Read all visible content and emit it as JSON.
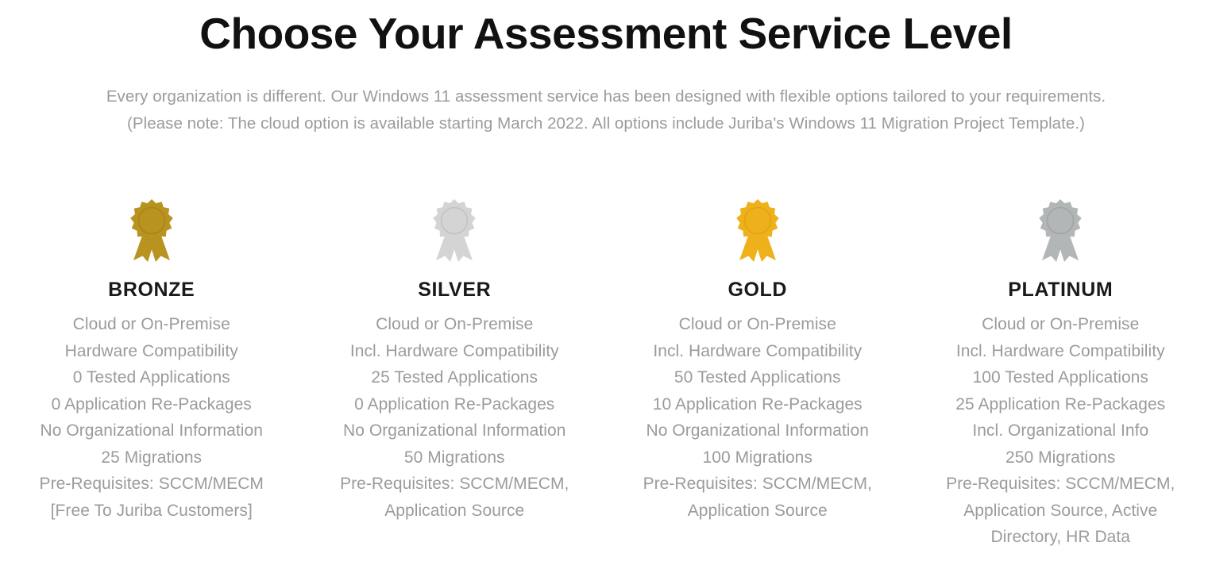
{
  "header": {
    "title": "Choose Your Assessment Service Level",
    "intro_line_1": "Every organization is different. Our Windows 11 assessment service has been designed with flexible options tailored to your requirements.",
    "intro_line_2": "(Please note: The cloud option is available starting March 2022. All options include Juriba's Windows 11 Migration Project Template.)"
  },
  "colors": {
    "title": "#111111",
    "body_text": "#9b9b9b",
    "background": "#ffffff",
    "bronze": "#b8931f",
    "bronze_dark": "#a98317",
    "silver": "#d4d4d4",
    "silver_dark": "#c2c2c2",
    "gold": "#eeb11c",
    "gold_dark": "#e0a313",
    "platinum": "#b3b6b7",
    "platinum_dark": "#a0a4a5"
  },
  "tiers": [
    {
      "name": "BRONZE",
      "medal_icon": "award-ribbon-icon",
      "medal_color": "#b8931f",
      "medal_color_dark": "#a98317",
      "features": [
        "Cloud or On-Premise",
        "Hardware Compatibility",
        "0 Tested Applications",
        "0 Application Re-Packages",
        "No Organizational Information",
        "25 Migrations",
        "Pre-Requisites: SCCM/MECM",
        "[Free To Juriba Customers]"
      ]
    },
    {
      "name": "SILVER",
      "medal_icon": "award-ribbon-icon",
      "medal_color": "#d4d4d4",
      "medal_color_dark": "#c2c2c2",
      "features": [
        "Cloud or On-Premise",
        "Incl. Hardware Compatibility",
        "25 Tested Applications",
        "0 Application Re-Packages",
        "No Organizational Information",
        "50 Migrations",
        "Pre-Requisites: SCCM/MECM,",
        "Application Source"
      ]
    },
    {
      "name": "GOLD",
      "medal_icon": "award-ribbon-icon",
      "medal_color": "#eeb11c",
      "medal_color_dark": "#e0a313",
      "features": [
        "Cloud or On-Premise",
        "Incl. Hardware Compatibility",
        "50 Tested Applications",
        "10 Application Re-Packages",
        "No Organizational Information",
        "100 Migrations",
        "Pre-Requisites: SCCM/MECM,",
        "Application Source"
      ]
    },
    {
      "name": "PLATINUM",
      "medal_icon": "award-ribbon-icon",
      "medal_color": "#b3b6b7",
      "medal_color_dark": "#a0a4a5",
      "features": [
        "Cloud or On-Premise",
        "Incl. Hardware Compatibility",
        "100 Tested Applications",
        "25 Application Re-Packages",
        "Incl. Organizational Info",
        "250 Migrations",
        "Pre-Requisites: SCCM/MECM,",
        "Application Source, Active",
        "Directory, HR Data"
      ]
    }
  ]
}
